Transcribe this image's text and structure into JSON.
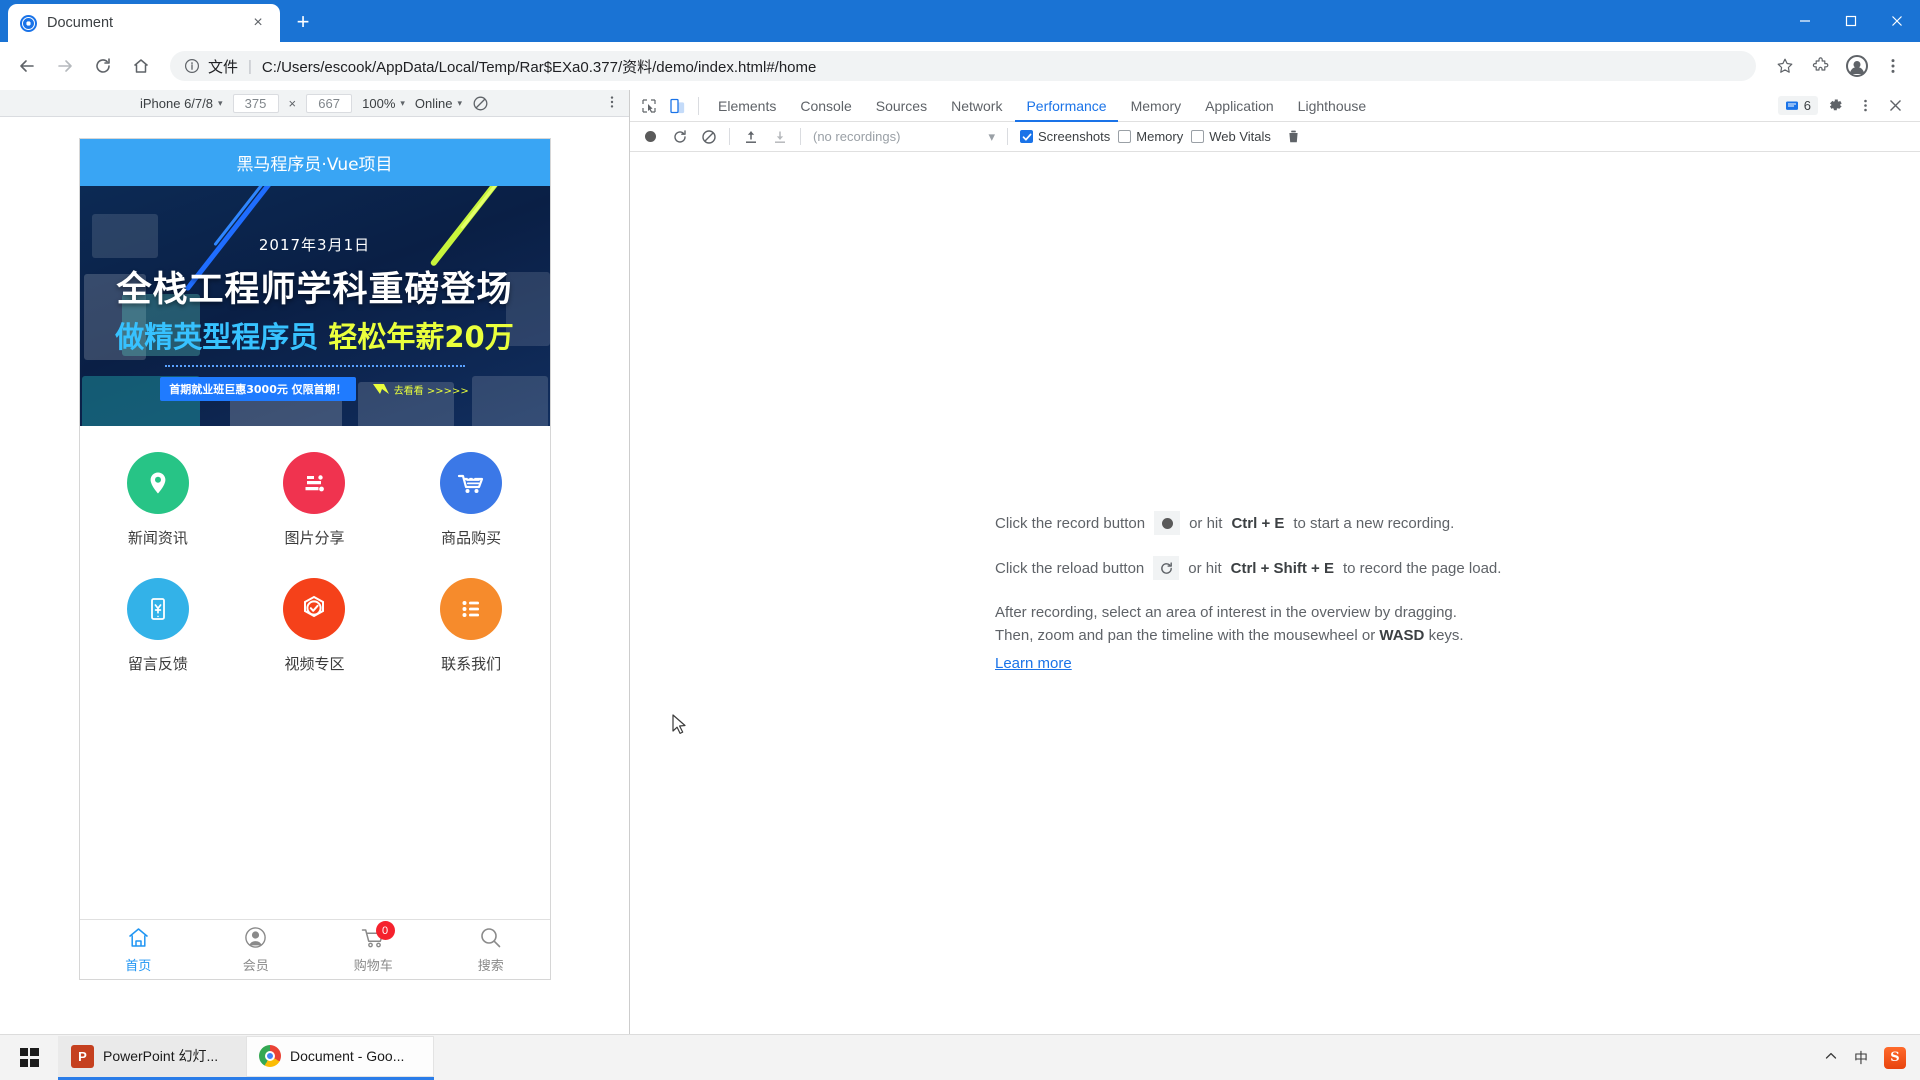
{
  "browser": {
    "tab": {
      "title": "Document",
      "favicon": "globe-icon",
      "close": "×"
    },
    "newtab_label": "+",
    "window_controls": {
      "minimize": "minimize-icon",
      "maximize": "maximize-icon",
      "close": "close-icon"
    },
    "nav": {
      "back": "back-arrow-icon",
      "forward": "forward-arrow-icon",
      "reload": "reload-icon",
      "home": "home-icon"
    },
    "omnibox": {
      "info_icon": "info-circle-icon",
      "scheme_label": "文件",
      "separator": "|",
      "url": "C:/Users/escook/AppData/Local/Temp/Rar$EXa0.377/资料/demo/index.html#/home"
    },
    "toolbar_right": {
      "bookmark": "star-icon",
      "extensions": "puzzle-icon",
      "profile": "avatar-icon",
      "menu": "kebab-menu-icon"
    }
  },
  "device_toolbar": {
    "device": "iPhone 6/7/8",
    "width": "375",
    "height": "667",
    "times": "×",
    "zoom": "100%",
    "throttle": "Online",
    "rotate_icon": "rotate-icon",
    "more_icon": "kebab-menu-icon",
    "caret": "▾"
  },
  "mobile_page": {
    "header_title": "黑马程序员·Vue项目",
    "banner": {
      "date": "2017年3月1日",
      "headline": "全栈工程师学科重磅登场",
      "sub_a": "做精英型程序员",
      "sub_b": "轻松年薪20万",
      "pill": "首期就业班巨惠3000元 仅限首期！",
      "link": "去看看 >>>>>"
    },
    "grid": [
      {
        "label": "新闻资讯",
        "icon": "location-pin-icon",
        "color": "#27c486"
      },
      {
        "label": "图片分享",
        "icon": "dianping-icon",
        "color": "#f0334f"
      },
      {
        "label": "商品购买",
        "icon": "shopping-cart-icon",
        "color": "#3b78e7"
      },
      {
        "label": "留言反馈",
        "icon": "mobile-yuan-icon",
        "color": "#33b2e8"
      },
      {
        "label": "视频专区",
        "icon": "check-shield-icon",
        "color": "#f5411a"
      },
      {
        "label": "联系我们",
        "icon": "list-icon",
        "color": "#f68b2c"
      }
    ],
    "tabbar": [
      {
        "label": "首页",
        "icon": "home-icon",
        "active": true,
        "badge": null
      },
      {
        "label": "会员",
        "icon": "user-icon",
        "active": false,
        "badge": null
      },
      {
        "label": "购物车",
        "icon": "cart-icon",
        "active": false,
        "badge": "0"
      },
      {
        "label": "搜索",
        "icon": "search-icon",
        "active": false,
        "badge": null
      }
    ],
    "accent_color": "#2196f3",
    "badge_color": "#f5222d"
  },
  "devtools": {
    "inspect_icon": "inspect-cursor-icon",
    "device_toggle_icon": "device-toolbar-icon",
    "tabs": [
      {
        "label": "Elements",
        "active": false
      },
      {
        "label": "Console",
        "active": false
      },
      {
        "label": "Sources",
        "active": false
      },
      {
        "label": "Network",
        "active": false
      },
      {
        "label": "Performance",
        "active": true
      },
      {
        "label": "Memory",
        "active": false
      },
      {
        "label": "Application",
        "active": false
      },
      {
        "label": "Lighthouse",
        "active": false
      }
    ],
    "messages_count": "6",
    "messages_icon": "message-icon",
    "settings_icon": "gear-icon",
    "more_icon": "kebab-menu-icon",
    "close_icon": "close-icon",
    "active_tab_color": "#1a73e8",
    "performance_toolbar": {
      "record_icon": "record-circle-icon",
      "reload_record_icon": "reload-icon",
      "clear_icon": "clear-icon",
      "load_profile_icon": "upload-arrow-icon",
      "save_profile_icon": "download-arrow-icon",
      "recordings_value": "(no recordings)",
      "recordings_caret": "▾",
      "checkboxes": [
        {
          "label": "Screenshots",
          "checked": true
        },
        {
          "label": "Memory",
          "checked": false
        },
        {
          "label": "Web Vitals",
          "checked": false
        }
      ],
      "trash_icon": "trash-icon"
    },
    "empty_state": {
      "line1_pre": "Click the record button",
      "line1_mid": "or hit",
      "line1_key": "Ctrl + E",
      "line1_post": "to start a new recording.",
      "line2_pre": "Click the reload button",
      "line2_mid": "or hit",
      "line2_key": "Ctrl + Shift + E",
      "line2_post": "to record the page load.",
      "line3": "After recording, select an area of interest in the overview by dragging.",
      "line4_pre": "Then, zoom and pan the timeline with the mousewheel or",
      "line4_key": "WASD",
      "line4_post": "keys.",
      "learn_more": "Learn more"
    }
  },
  "taskbar": {
    "start_icon": "windows-logo-icon",
    "items": [
      {
        "label": "PowerPoint 幻灯...",
        "icon": "powerpoint-icon",
        "active": false
      },
      {
        "label": "Document - Goo...",
        "icon": "chrome-icon",
        "active": true
      }
    ],
    "tray": {
      "chevron": "chevron-up-icon",
      "ime": "中",
      "sogou": "S"
    }
  }
}
